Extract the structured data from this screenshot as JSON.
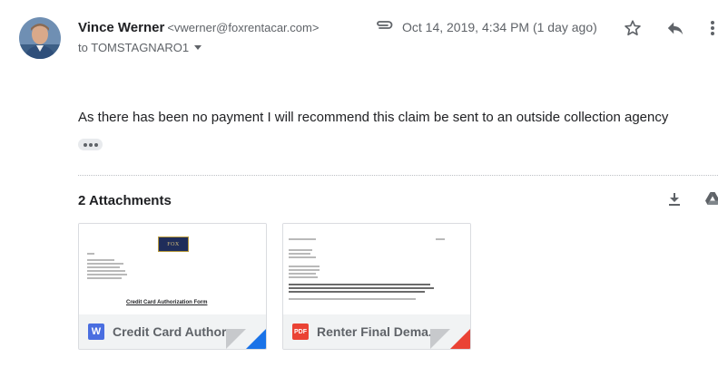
{
  "sender": {
    "name": "Vince Werner",
    "email": "<vwerner@foxrentacar.com>",
    "to_prefix": "to",
    "to_name": "TOMSTAGNARO1"
  },
  "meta": {
    "date": "Oct 14, 2019, 4:34 PM (1 day ago)"
  },
  "icons": {
    "attachment": "paperclip-icon",
    "star": "star-icon",
    "reply": "reply-icon",
    "more": "more-vertical-icon",
    "download": "download-icon",
    "drive": "google-drive-icon"
  },
  "body": {
    "text": "As there has been no payment I will recommend this claim be sent to an outside collection agency"
  },
  "attachments": {
    "heading": "2 Attachments",
    "items": [
      {
        "name": "Credit Card Authorization Form",
        "display_name": "Credit Card Author...",
        "type_label": "W",
        "type_color": "#4a6ee0",
        "corner_color": "#1a73e8",
        "preview_logo": "FOX",
        "preview_title": "Credit Card Authorization Form"
      },
      {
        "name": "Renter Final Demand",
        "display_name": "Renter Final Dema...",
        "type_label": "PDF",
        "type_color": "#ea4335",
        "corner_color": "#ea4335"
      }
    ]
  },
  "colors": {
    "text_primary": "#202124",
    "text_secondary": "#5f6368",
    "icon_gray": "#5f6368",
    "footer_bg": "#f1f3f4"
  }
}
